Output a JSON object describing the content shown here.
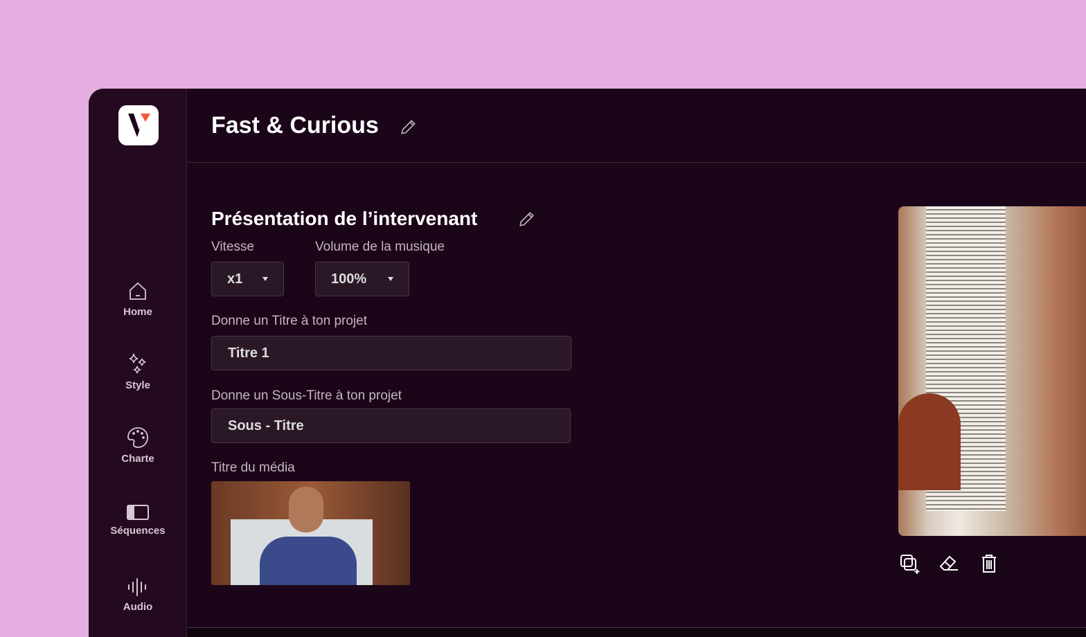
{
  "sidebar": {
    "items": [
      {
        "label": "Home",
        "icon": "home-icon"
      },
      {
        "label": "Style",
        "icon": "sparkles-icon"
      },
      {
        "label": "Charte",
        "icon": "palette-icon"
      },
      {
        "label": "Séquences",
        "icon": "sequences-icon"
      },
      {
        "label": "Audio",
        "icon": "audio-icon"
      }
    ]
  },
  "header": {
    "title": "Fast & Curious"
  },
  "section": {
    "title": "Présentation de l’intervenant",
    "speed_label": "Vitesse",
    "speed_value": "x1",
    "volume_label": "Volume de la musique",
    "volume_value": "100%",
    "title_label": "Donne un Titre à ton projet",
    "title_value": "Titre 1",
    "subtitle_label": "Donne un Sous-Titre à ton projet",
    "subtitle_value": "Sous - Titre",
    "media_label": "Titre du média"
  },
  "colors": {
    "accent": "#f05a3c",
    "background": "#1b0619",
    "sidebar": "#240a21"
  }
}
